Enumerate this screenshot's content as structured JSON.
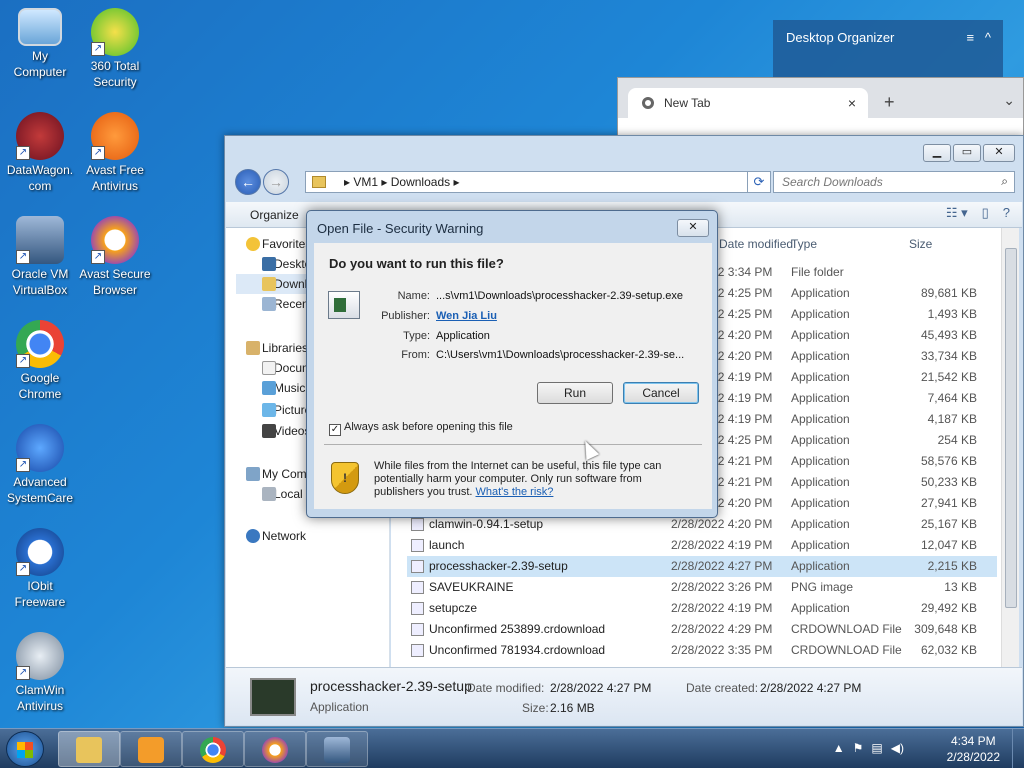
{
  "desktop": {
    "icons": [
      {
        "label": "My\nComputer",
        "l1": "My",
        "l2": "Computer"
      },
      {
        "l1": "360 Total",
        "l2": "Security"
      },
      {
        "l1": "DataWagon.",
        "l2": "com"
      },
      {
        "l1": "Avast Free",
        "l2": "Antivirus"
      },
      {
        "l1": "Oracle VM",
        "l2": "VirtualBox"
      },
      {
        "l1": "Avast Secure",
        "l2": "Browser"
      },
      {
        "l1": "Google",
        "l2": "Chrome"
      },
      {
        "l1": "Advanced",
        "l2": "SystemCare"
      },
      {
        "l1": "IObit",
        "l2": "Freeware"
      },
      {
        "l1": "ClamWin",
        "l2": "Antivirus"
      }
    ]
  },
  "organizer": {
    "title": "Desktop Organizer",
    "menu_icon": "≡",
    "collapse_icon": "^"
  },
  "chrome": {
    "tab_title": "New Tab",
    "close": "×",
    "new_tab": "+",
    "caret": "⌄"
  },
  "explorer": {
    "path": [
      "VM1",
      "Downloads"
    ],
    "search_placeholder": "Search Downloads",
    "organize": "Organize",
    "nav": {
      "favorites": "Favorites",
      "desktop": "Desktop",
      "downloads": "Downloads",
      "recent": "Recent Places",
      "libraries": "Libraries",
      "documents": "Documents",
      "music": "Music",
      "pictures": "Pictures",
      "videos": "Videos",
      "computer": "My Computer",
      "local": "Local Disk",
      "network": "Network"
    },
    "columns": {
      "modified": "Date modified",
      "type": "Type",
      "size": "Size"
    },
    "rows": [
      {
        "name": "",
        "date": "2/28/2022 3:34 PM",
        "type": "File folder",
        "size": ""
      },
      {
        "name": "",
        "date": "2/28/2022 4:25 PM",
        "type": "Application",
        "size": "89,681 KB"
      },
      {
        "name": "",
        "date": "2/28/2022 4:25 PM",
        "type": "Application",
        "size": "1,493 KB"
      },
      {
        "name": "",
        "date": "2/28/2022 4:20 PM",
        "type": "Application",
        "size": "45,493 KB"
      },
      {
        "name": "",
        "date": "2/28/2022 4:20 PM",
        "type": "Application",
        "size": "33,734 KB"
      },
      {
        "name": "",
        "date": "2/28/2022 4:19 PM",
        "type": "Application",
        "size": "21,542 KB"
      },
      {
        "name": "",
        "date": "2/28/2022 4:19 PM",
        "type": "Application",
        "size": "7,464 KB"
      },
      {
        "name": "",
        "date": "2/28/2022 4:19 PM",
        "type": "Application",
        "size": "4,187 KB"
      },
      {
        "name": "",
        "date": "2/28/2022 4:25 PM",
        "type": "Application",
        "size": "254 KB"
      },
      {
        "name": "",
        "date": "2/28/2022 4:21 PM",
        "type": "Application",
        "size": "58,576 KB"
      },
      {
        "name": "",
        "date": "2/28/2022 4:21 PM",
        "type": "Application",
        "size": "50,233 KB"
      },
      {
        "name": "",
        "date": "2/28/2022 4:20 PM",
        "type": "Application",
        "size": "27,941 KB"
      },
      {
        "name": "clamwin-0.94.1-setup",
        "date": "2/28/2022 4:20 PM",
        "type": "Application",
        "size": "25,167 KB"
      },
      {
        "name": "launch",
        "date": "2/28/2022 4:19 PM",
        "type": "Application",
        "size": "12,047 KB"
      },
      {
        "name": "processhacker-2.39-setup",
        "date": "2/28/2022 4:27 PM",
        "type": "Application",
        "size": "2,215 KB"
      },
      {
        "name": "SAVEUKRAINE",
        "date": "2/28/2022 3:26 PM",
        "type": "PNG image",
        "size": "13 KB"
      },
      {
        "name": "setupcze",
        "date": "2/28/2022 4:19 PM",
        "type": "Application",
        "size": "29,492 KB"
      },
      {
        "name": "Unconfirmed 253899.crdownload",
        "date": "2/28/2022 4:29 PM",
        "type": "CRDOWNLOAD File",
        "size": "309,648 KB"
      },
      {
        "name": "Unconfirmed 781934.crdownload",
        "date": "2/28/2022 3:35 PM",
        "type": "CRDOWNLOAD File",
        "size": "62,032 KB"
      }
    ],
    "details": {
      "name": "processhacker-2.39-setup",
      "kind": "Application",
      "modified_label": "Date modified:",
      "modified": "2/28/2022 4:27 PM",
      "created_label": "Date created:",
      "created": "2/28/2022 4:27 PM",
      "size_label": "Size:",
      "size": "2.16 MB"
    }
  },
  "dialog": {
    "title": "Open File - Security Warning",
    "question": "Do you want to run this file?",
    "name_label": "Name:",
    "name": "...s\\vm1\\Downloads\\processhacker-2.39-setup.exe",
    "publisher_label": "Publisher:",
    "publisher": "Wen Jia Liu",
    "type_label": "Type:",
    "type": "Application",
    "from_label": "From:",
    "from": "C:\\Users\\vm1\\Downloads\\processhacker-2.39-se...",
    "run": "Run",
    "cancel": "Cancel",
    "checkbox": "Always ask before opening this file",
    "warning": "While files from the Internet can be useful, this file type can potentially harm your computer. Only run software from publishers you trust.",
    "risk_link": "What's the risk?"
  },
  "taskbar": {
    "time": "4:34 PM",
    "date": "2/28/2022"
  }
}
